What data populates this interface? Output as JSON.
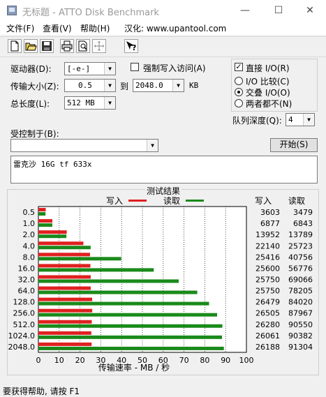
{
  "window": {
    "title": "无标题 - ATTO Disk Benchmark",
    "minimize_glyph": "—",
    "maximize_glyph": "☐",
    "close_glyph": "✕"
  },
  "menu": {
    "items": [
      "文件(F)",
      "查看(V)",
      "帮助(H)",
      "汉化: www.upantool.com"
    ]
  },
  "toolbar": {
    "icons": [
      "new-document-icon",
      "open-folder-icon",
      "save-icon",
      "print-icon",
      "print-preview-icon",
      "move-icon",
      "help-icon"
    ]
  },
  "settings": {
    "drive_label": "驱动器(D):",
    "drive_value": "[-e-]",
    "force_write_label": "强制写入访问(A)",
    "force_write_checked": false,
    "transfer_label": "传输大小(Z):",
    "transfer_from": "0.5",
    "to_label": "到",
    "transfer_to": "2048.0",
    "kb_unit": "KB",
    "total_label": "总长度(L):",
    "total_value": "512 MB"
  },
  "io": {
    "direct_label": "直接 I/O(R)",
    "direct_checked": true,
    "options": [
      {
        "label": "I/O 比较(C)",
        "selected": false
      },
      {
        "label": "交叠 I/O(O)",
        "selected": true
      },
      {
        "label": "两者都不(N)",
        "selected": false
      }
    ],
    "queue_label": "队列深度(Q):",
    "queue_value": "4"
  },
  "controlled": {
    "label": "受控制于(B):",
    "value": "",
    "start_button": "开始(S)"
  },
  "description": "雷克沙 16G tf 633x",
  "results": {
    "group_title": "测试结果",
    "legend_write": "写入",
    "legend_read": "读取",
    "col_write": "写入",
    "col_read": "读取",
    "colors": {
      "write": "#e02020",
      "read": "#1a8a1a"
    }
  },
  "chart_data": {
    "type": "bar",
    "orientation": "horizontal",
    "categories": [
      "0.5",
      "1.0",
      "2.0",
      "4.0",
      "8.0",
      "16.0",
      "32.0",
      "64.0",
      "128.0",
      "256.0",
      "512.0",
      "1024.0",
      "2048.0"
    ],
    "series": [
      {
        "name": "写入",
        "values": [
          3603,
          6877,
          13952,
          22140,
          25416,
          25600,
          25750,
          25750,
          26479,
          26505,
          26280,
          26061,
          26188
        ]
      },
      {
        "name": "读取",
        "values": [
          3479,
          6843,
          13789,
          25723,
          40756,
          56776,
          69066,
          78205,
          84020,
          87967,
          90550,
          90382,
          91304
        ]
      }
    ],
    "xticks": [
      "0",
      "10",
      "20",
      "30",
      "40",
      "50",
      "60",
      "70",
      "80",
      "90",
      "100"
    ],
    "xlim": [
      0,
      100
    ],
    "xlabel": "传输速率 - MB / 秒",
    "grid": true,
    "legend": "top"
  },
  "status": {
    "text": "要获得帮助, 请按 F1"
  }
}
